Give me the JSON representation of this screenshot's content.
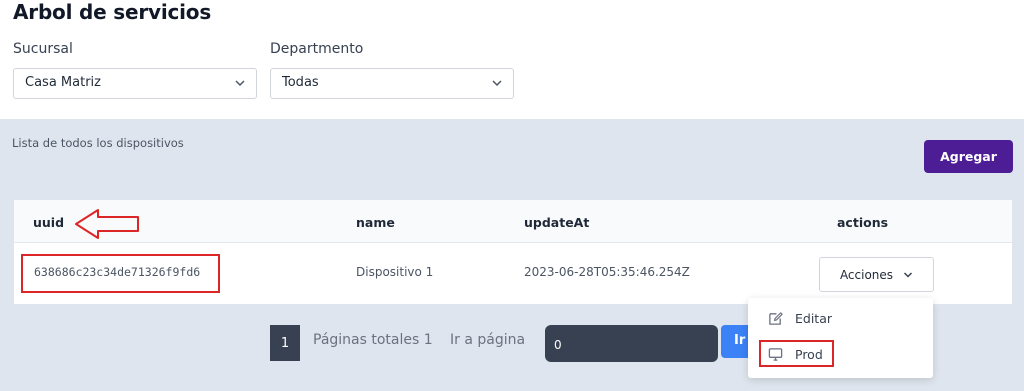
{
  "page": {
    "title": "Arbol de servicios"
  },
  "filters": {
    "sucursal": {
      "label": "Sucursal",
      "value": "Casa Matriz"
    },
    "departamento": {
      "label": "Departmento",
      "value": "Todas"
    }
  },
  "list": {
    "caption": "Lista de todos los dispositivos",
    "add_label": "Agregar",
    "columns": [
      "uuid",
      "name",
      "updateAt",
      "actions"
    ],
    "rows": [
      {
        "uuid": "638686c23c34de71326f9fd6",
        "name": "Dispositivo 1",
        "updateAt": "2023-06-28T05:35:46.254Z",
        "actions_label": "Acciones"
      }
    ]
  },
  "actions_menu": {
    "items": [
      {
        "label": "Editar",
        "icon": "edit-icon"
      },
      {
        "label": "Prod",
        "icon": "monitor-icon"
      }
    ]
  },
  "pagination": {
    "current_page": "1",
    "total_label": "Páginas totales 1",
    "goto_label": "Ir a página",
    "goto_value": "0",
    "go_label": "Ir"
  },
  "colors": {
    "primary": "#4c1d95",
    "go_button": "#3b82f6",
    "panel_bg": "#dfe5ee",
    "highlight": "#dc2626"
  }
}
